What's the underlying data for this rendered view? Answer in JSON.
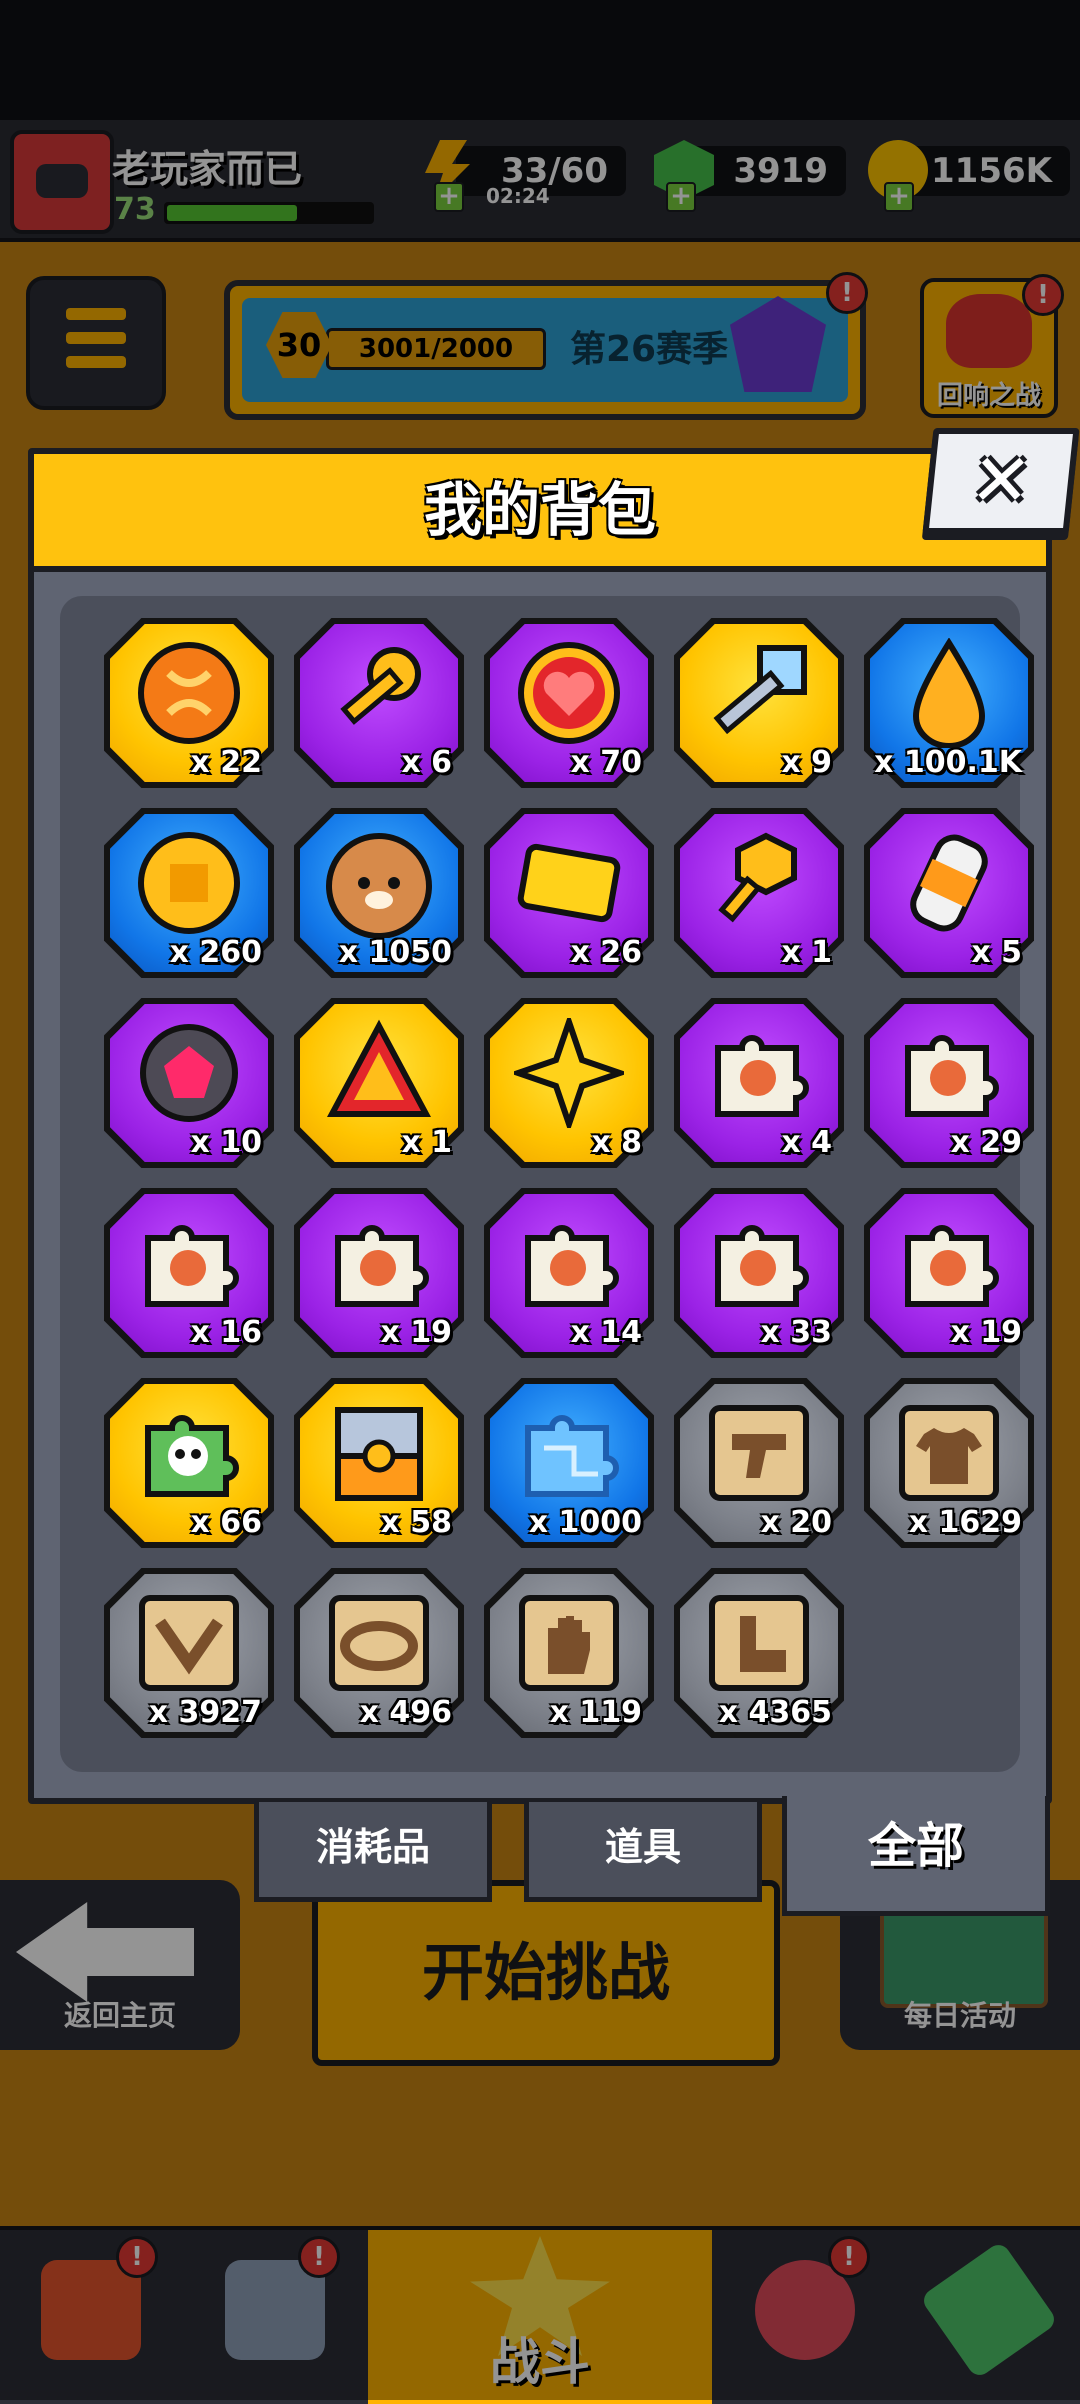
{
  "player": {
    "name": "老玩家而已",
    "level": "73"
  },
  "resources": {
    "energy": "33/60",
    "energy_timer": "02:24",
    "gems": "3919",
    "coins": "1156K"
  },
  "season": {
    "level": "30",
    "progress": "3001/2000",
    "name": "第26赛季"
  },
  "echo_battle_label": "回响之战",
  "notification_mark": "!",
  "bottom_bar": {
    "back_home": "返回主页",
    "start_challenge": "开始挑战",
    "daily_activity": "每日活动",
    "battle_tab": "战斗"
  },
  "inventory": {
    "title": "我的背包",
    "close_symbol": "✕",
    "tabs": [
      {
        "label": "消耗品",
        "active": false
      },
      {
        "label": "道具",
        "active": false
      },
      {
        "label": "全部",
        "active": true
      }
    ],
    "items": [
      {
        "icon": "orange-dna-orb-icon",
        "rarity": "gold",
        "count": "x 22"
      },
      {
        "icon": "gold-key-icon",
        "rarity": "purple",
        "count": "x 6"
      },
      {
        "icon": "heart-medal-icon",
        "rarity": "purple",
        "count": "x 70"
      },
      {
        "icon": "crystal-key-icon",
        "rarity": "gold",
        "count": "x 9"
      },
      {
        "icon": "oil-drop-icon",
        "rarity": "blue",
        "count": "x 100.1K"
      },
      {
        "icon": "gold-coin-icon",
        "rarity": "blue",
        "count": "x 260"
      },
      {
        "icon": "dog-cookie-icon",
        "rarity": "blue",
        "count": "x 1050"
      },
      {
        "icon": "gold-ticket-icon",
        "rarity": "purple",
        "count": "x 26"
      },
      {
        "icon": "hex-key-icon",
        "rarity": "purple",
        "count": "x 1"
      },
      {
        "icon": "capsule-icon",
        "rarity": "purple",
        "count": "x 5"
      },
      {
        "icon": "ruby-orb-icon",
        "rarity": "purple",
        "count": "x 10"
      },
      {
        "icon": "red-triangle-icon",
        "rarity": "gold",
        "count": "x 1"
      },
      {
        "icon": "gold-star-icon",
        "rarity": "gold",
        "count": "x 8"
      },
      {
        "icon": "puzzle-hero-icon",
        "rarity": "purple",
        "count": "x 4"
      },
      {
        "icon": "puzzle-hero-icon",
        "rarity": "purple",
        "count": "x 29"
      },
      {
        "icon": "puzzle-hero-icon",
        "rarity": "purple",
        "count": "x 16"
      },
      {
        "icon": "puzzle-hero-icon",
        "rarity": "purple",
        "count": "x 19"
      },
      {
        "icon": "puzzle-hero-icon",
        "rarity": "purple",
        "count": "x 14"
      },
      {
        "icon": "puzzle-hero-icon",
        "rarity": "purple",
        "count": "x 33"
      },
      {
        "icon": "puzzle-hero-icon",
        "rarity": "purple",
        "count": "x 19"
      },
      {
        "icon": "puzzle-skull-icon",
        "rarity": "gold",
        "count": "x 66"
      },
      {
        "icon": "treasure-chest-icon",
        "rarity": "gold",
        "count": "x 58"
      },
      {
        "icon": "circuit-puzzle-icon",
        "rarity": "blue",
        "count": "x 1000"
      },
      {
        "icon": "blueprint-gun-icon",
        "rarity": "gray",
        "count": "x 20"
      },
      {
        "icon": "blueprint-shirt-icon",
        "rarity": "gray",
        "count": "x 1629"
      },
      {
        "icon": "blueprint-necklace-icon",
        "rarity": "gray",
        "count": "x 3927"
      },
      {
        "icon": "blueprint-belt-icon",
        "rarity": "gray",
        "count": "x 496"
      },
      {
        "icon": "blueprint-glove-icon",
        "rarity": "gray",
        "count": "x 119"
      },
      {
        "icon": "blueprint-boot-icon",
        "rarity": "gray",
        "count": "x 4365"
      }
    ]
  }
}
